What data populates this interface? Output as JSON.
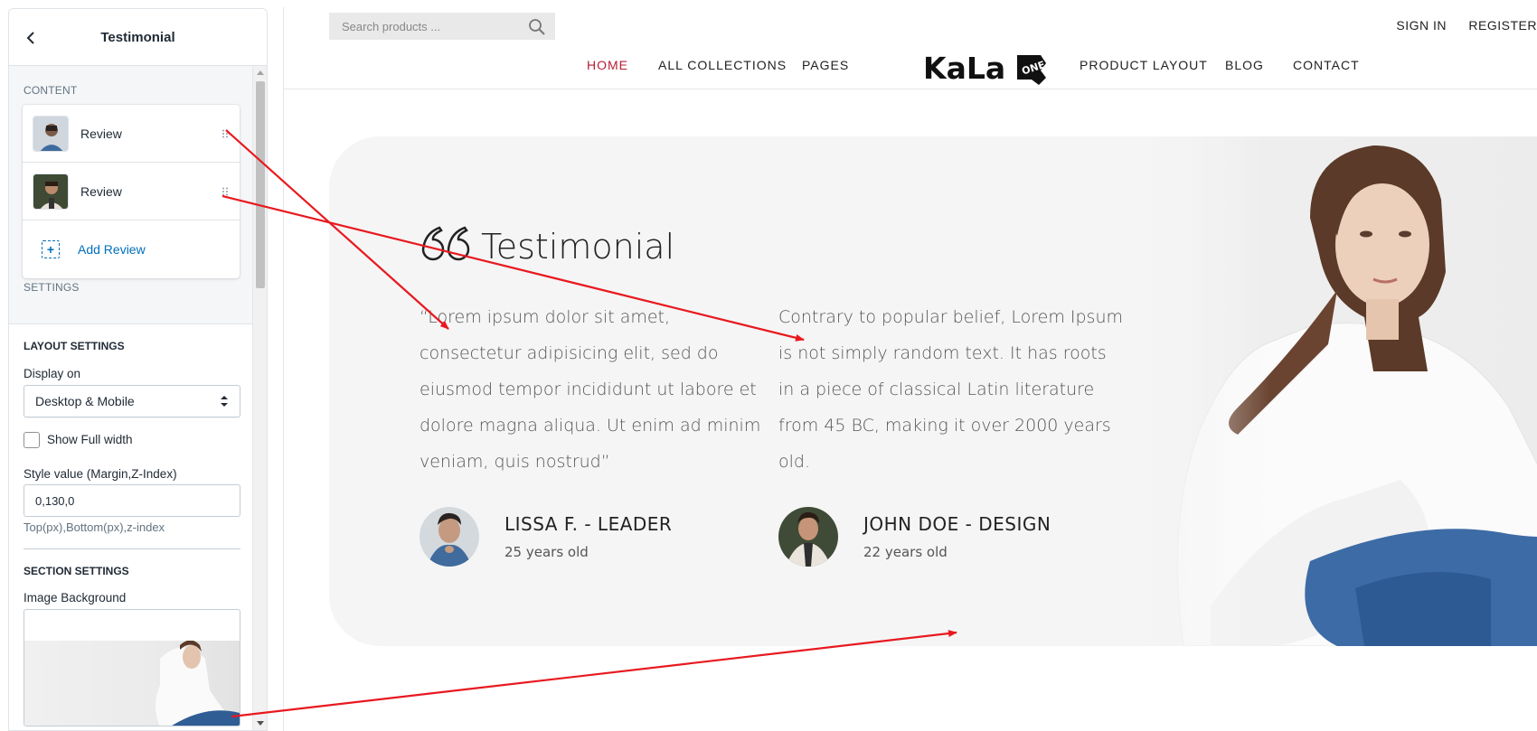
{
  "sidebar": {
    "title": "Testimonial",
    "content_label": "CONTENT",
    "blocks": [
      {
        "label": "Review"
      },
      {
        "label": "Review"
      }
    ],
    "add_label": "Add Review",
    "settings_label": "SETTINGS",
    "layout_heading": "LAYOUT SETTINGS",
    "display_on_label": "Display on",
    "display_on_value": "Desktop & Mobile",
    "full_width_label": "Show Full width",
    "style_label": "Style value (Margin,Z-Index)",
    "style_value": "0,130,0",
    "style_help": "Top(px),Bottom(px),z-index",
    "section_heading": "SECTION SETTINGS",
    "image_bg_label": "Image Background"
  },
  "store": {
    "search_placeholder": "Search products ...",
    "sign_in": "SIGN IN",
    "register": "REGISTER",
    "nav": {
      "home": "HOME",
      "collections": "ALL COLLECTIONS",
      "pages": "PAGES",
      "product_layout": "PRODUCT LAYOUT",
      "blog": "BLOG",
      "contact": "CONTACT"
    },
    "logo_text": "KaLa",
    "logo_badge": "ONE",
    "accent_color": "#b51e35"
  },
  "testimonial": {
    "title": "Testimonial",
    "reviews": [
      {
        "quote": "“Lorem ipsum dolor sit amet, consectetur adipisicing elit, sed do eiusmod tempor incididunt ut labore et dolore magna aliqua. Ut enim ad minim veniam, quis nostrud”",
        "name": "LISSA F. - LEADER",
        "age": "25 years old"
      },
      {
        "quote": "Contrary to popular belief, Lorem Ipsum is not simply random text. It has roots in a piece of classical Latin literature from 45 BC, making it over 2000 years old.",
        "name": "JOHN DOE - DESIGN",
        "age": "22 years old"
      }
    ]
  },
  "annotation_color": "#e8191f"
}
